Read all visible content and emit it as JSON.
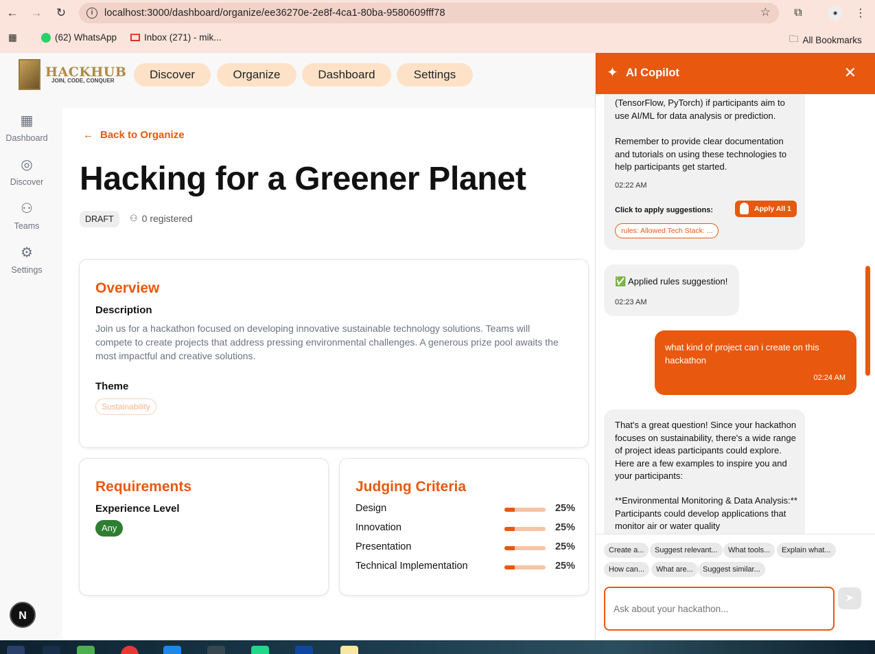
{
  "browser": {
    "url": "localhost:3000/dashboard/organize/ee36270e-2e8f-4ca1-80ba-9580609fff78",
    "bookmarks": [
      "(62) WhatsApp",
      "Inbox (271) - mik...",
      "All Bookmarks"
    ]
  },
  "logo": {
    "name": "HACKHUB",
    "tagline": "JOIN, CODE, CONQUER"
  },
  "topnav": [
    "Discover",
    "Organize",
    "Dashboard",
    "Settings"
  ],
  "sidebar": [
    {
      "label": "Dashboard",
      "icon": "grid-icon"
    },
    {
      "label": "Discover",
      "icon": "compass-icon"
    },
    {
      "label": "Teams",
      "icon": "users-icon"
    },
    {
      "label": "Settings",
      "icon": "gear-icon"
    }
  ],
  "page": {
    "back_label": "Back to Organize",
    "title": "Hacking for a Greener Planet",
    "status": "DRAFT",
    "registered": "0 registered"
  },
  "overview": {
    "heading": "Overview",
    "description_label": "Description",
    "description": "Join us for a hackathon focused on developing innovative sustainable technology solutions. Teams will compete to create projects that address pressing environmental challenges. A generous prize pool awaits the most impactful and creative solutions.",
    "theme_label": "Theme",
    "theme": "Sustainability"
  },
  "requirements": {
    "heading": "Requirements",
    "experience_label": "Experience Level",
    "experience": "Any"
  },
  "judging": {
    "heading": "Judging Criteria",
    "criteria": [
      {
        "name": "Design",
        "pct": "25%",
        "value": 0.25
      },
      {
        "name": "Innovation",
        "pct": "25%",
        "value": 0.25
      },
      {
        "name": "Presentation",
        "pct": "25%",
        "value": 0.25
      },
      {
        "name": "Technical Implementation",
        "pct": "25%",
        "value": 0.25
      }
    ]
  },
  "copilot": {
    "title": "AI Copilot",
    "msg1_line1": "(TensorFlow, PyTorch) if participants aim to",
    "msg1_line2": "use AI/ML for data analysis or prediction.",
    "msg1_p2": "Remember to provide clear documentation and tutorials on using these technologies to help participants get started.",
    "msg1_time": "02:22 AM",
    "apply_label": "Click to apply suggestions:",
    "apply_all": "Apply All 1",
    "suggestion_tag": "rules: Allowed Tech Stack: ...",
    "msg2": "✅ Applied rules suggestion!",
    "msg2_time": "02:23 AM",
    "user_msg": "what kind of project can i create on this hackathon",
    "user_time": "02:24 AM",
    "msg3_p1": "That's a great question!  Since your hackathon focuses on sustainability, there's a wide range of project ideas participants could explore.  Here are a few examples to inspire you and your participants:",
    "msg3_p2": "**Environmental Monitoring & Data Analysis:**  Participants could develop applications that monitor air or water quality",
    "chips": [
      "Create a...",
      "Suggest relevant...",
      "What tools...",
      "Explain what...",
      "How can...",
      "What are...",
      "Suggest similar..."
    ],
    "input_placeholder": "Ask about your hackathon..."
  },
  "colors": {
    "accent": "#e8580f",
    "any_badge": "#2e7d32"
  }
}
